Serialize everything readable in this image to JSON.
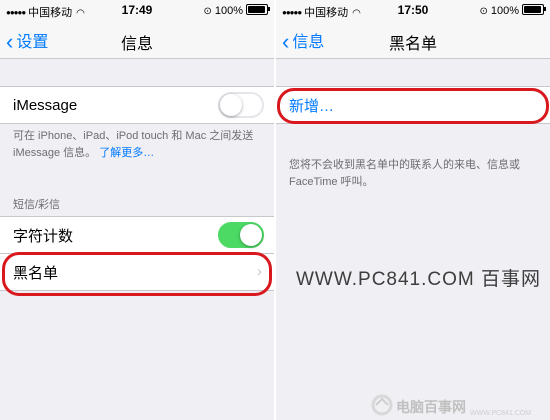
{
  "left": {
    "status": {
      "carrier": "中国移动",
      "time": "17:49",
      "battery": "100%"
    },
    "nav": {
      "back_label": "设置",
      "title": "信息"
    },
    "imessage": {
      "label": "iMessage",
      "on": false
    },
    "imessage_note": {
      "text": "可在 iPhone、iPad、iPod touch 和 Mac 之间发送 iMessage 信息。",
      "link": "了解更多…"
    },
    "sms_header": "短信/彩信",
    "char_count": {
      "label": "字符计数",
      "on": true
    },
    "blacklist": {
      "label": "黑名单"
    }
  },
  "right": {
    "status": {
      "carrier": "中国移动",
      "time": "17:50",
      "battery": "100%"
    },
    "nav": {
      "back_label": "信息",
      "title": "黑名单"
    },
    "add_new": "新增…",
    "note": "您将不会收到黑名单中的联系人的来电、信息或 FaceTime 呼叫。"
  },
  "watermark": "WWW.PC841.COM 百事网",
  "logo": {
    "name": "电脑百事网",
    "url": "WWW.PC841.COM"
  },
  "colors": {
    "accent": "#007aff",
    "highlight": "#d9181e",
    "toggle_on": "#4cd964",
    "background": "#efeff4"
  }
}
